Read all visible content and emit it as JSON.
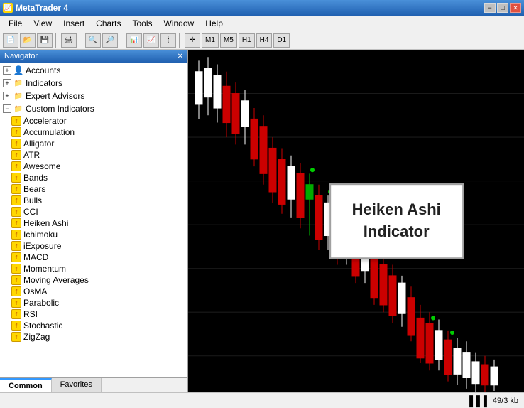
{
  "titleBar": {
    "title": "MetaTrader 4",
    "minLabel": "−",
    "maxLabel": "□",
    "closeLabel": "✕"
  },
  "menuBar": {
    "items": [
      "File",
      "View",
      "Insert",
      "Charts",
      "Tools",
      "Window",
      "Help"
    ]
  },
  "navigator": {
    "title": "Navigator",
    "closeLabel": "✕",
    "tree": [
      {
        "id": "accounts",
        "label": "Accounts",
        "level": 0,
        "type": "expandable",
        "expanded": true
      },
      {
        "id": "indicators",
        "label": "Indicators",
        "level": 0,
        "type": "expandable",
        "expanded": false
      },
      {
        "id": "expert-advisors",
        "label": "Expert Advisors",
        "level": 0,
        "type": "expandable",
        "expanded": false
      },
      {
        "id": "custom-indicators",
        "label": "Custom Indicators",
        "level": 0,
        "type": "expandable",
        "expanded": true
      },
      {
        "id": "accelerator",
        "label": "Accelerator",
        "level": 1,
        "type": "indicator"
      },
      {
        "id": "accumulation",
        "label": "Accumulation",
        "level": 1,
        "type": "indicator"
      },
      {
        "id": "alligator",
        "label": "Alligator",
        "level": 1,
        "type": "indicator"
      },
      {
        "id": "atr",
        "label": "ATR",
        "level": 1,
        "type": "indicator"
      },
      {
        "id": "awesome",
        "label": "Awesome",
        "level": 1,
        "type": "indicator"
      },
      {
        "id": "bands",
        "label": "Bands",
        "level": 1,
        "type": "indicator"
      },
      {
        "id": "bears",
        "label": "Bears",
        "level": 1,
        "type": "indicator"
      },
      {
        "id": "bulls",
        "label": "Bulls",
        "level": 1,
        "type": "indicator"
      },
      {
        "id": "cci",
        "label": "CCI",
        "level": 1,
        "type": "indicator"
      },
      {
        "id": "heiken-ashi",
        "label": "Heiken Ashi",
        "level": 1,
        "type": "indicator"
      },
      {
        "id": "ichimoku",
        "label": "Ichimoku",
        "level": 1,
        "type": "indicator"
      },
      {
        "id": "iexposure",
        "label": "iExposure",
        "level": 1,
        "type": "indicator"
      },
      {
        "id": "macd",
        "label": "MACD",
        "level": 1,
        "type": "indicator"
      },
      {
        "id": "momentum",
        "label": "Momentum",
        "level": 1,
        "type": "indicator"
      },
      {
        "id": "moving-averages",
        "label": "Moving Averages",
        "level": 1,
        "type": "indicator"
      },
      {
        "id": "osma",
        "label": "OsMA",
        "level": 1,
        "type": "indicator"
      },
      {
        "id": "parabolic",
        "label": "Parabolic",
        "level": 1,
        "type": "indicator"
      },
      {
        "id": "rsi",
        "label": "RSI",
        "level": 1,
        "type": "indicator"
      },
      {
        "id": "stochastic",
        "label": "Stochastic",
        "level": 1,
        "type": "indicator"
      },
      {
        "id": "zigzag",
        "label": "ZigZag",
        "level": 1,
        "type": "indicator"
      }
    ],
    "tabs": [
      {
        "id": "common",
        "label": "Common",
        "active": true
      },
      {
        "id": "favorites",
        "label": "Favorites",
        "active": false
      }
    ]
  },
  "chart": {
    "label_line1": "Heiken Ashi",
    "label_line2": "Indicator"
  },
  "statusBar": {
    "chartIcon": "▐▐▐",
    "info": "49/3 kb"
  }
}
